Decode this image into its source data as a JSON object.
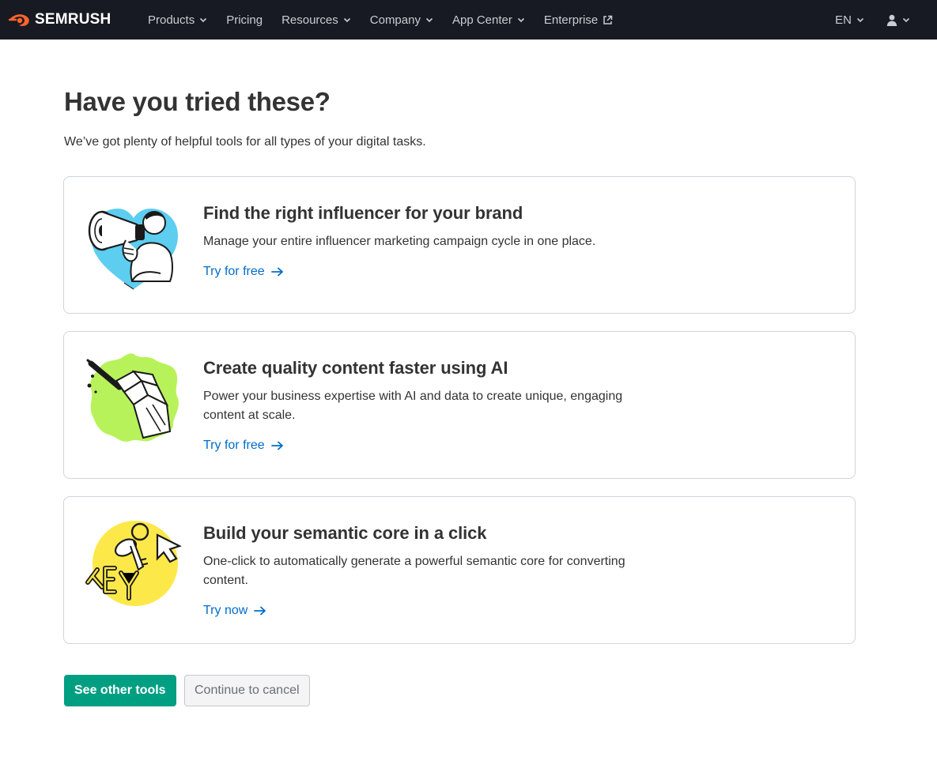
{
  "brand": {
    "name": "SEMRUSH",
    "accent": "#ff642d",
    "nav_bg": "#171a22"
  },
  "nav": {
    "items": [
      {
        "label": "Products",
        "has_dropdown": true
      },
      {
        "label": "Pricing",
        "has_dropdown": false
      },
      {
        "label": "Resources",
        "has_dropdown": true
      },
      {
        "label": "Company",
        "has_dropdown": true
      },
      {
        "label": "App Center",
        "has_dropdown": true
      },
      {
        "label": "Enterprise",
        "external": true
      }
    ],
    "language": "EN",
    "user_icon": "user-icon"
  },
  "page": {
    "title": "Have you tried these?",
    "subtitle": "We’ve got plenty of helpful tools for all types of your digital tasks."
  },
  "cards": [
    {
      "illustration": "megaphone-person-illustration",
      "title": "Find the right influencer for your brand",
      "description": "Manage your entire influencer marketing campaign cycle in one place.",
      "link": "Try for free",
      "illus_color": "#5dcdf0"
    },
    {
      "illustration": "robot-hand-pen-illustration",
      "title": "Create quality content faster using AI",
      "description": "Power your business expertise with AI and data to create unique, engaging content at scale.",
      "link": "Try for free",
      "illus_color": "#b8f25a"
    },
    {
      "illustration": "key-cursor-illustration",
      "title": "Build your semantic core in a click",
      "description": "One-click to automatically generate a powerful semantic core for converting content.",
      "link": "Try now",
      "illus_color": "#fde84a"
    }
  ],
  "actions": {
    "primary": "See other tools",
    "secondary": "Continue to cancel",
    "primary_color": "#009f81",
    "link_color": "#006dca"
  }
}
